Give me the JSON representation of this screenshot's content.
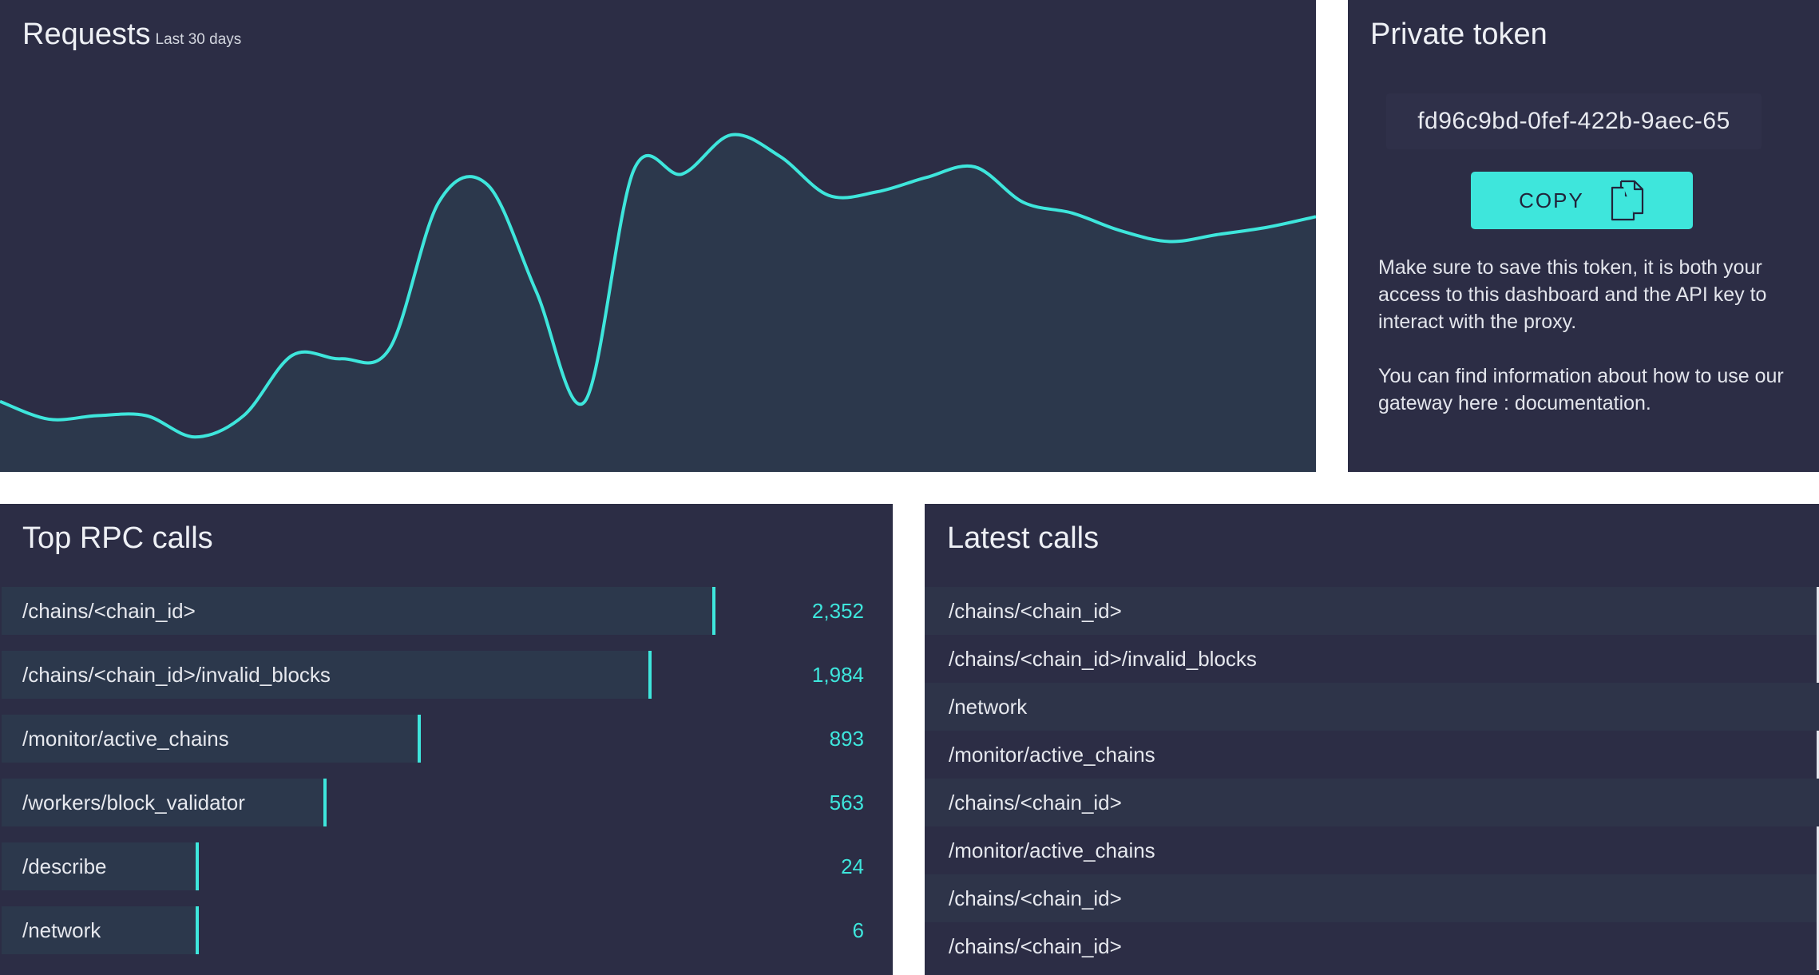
{
  "requests": {
    "title": "Requests",
    "subtitle": "Last 30 days",
    "colors": {
      "line": "#3ee6dc",
      "area": "#2c384c"
    }
  },
  "chart_data": {
    "type": "area",
    "title": "Requests",
    "subtitle": "Last 30 days",
    "xlabel": "",
    "ylabel": "",
    "grid": false,
    "legend": "none",
    "ylim": [
      0,
      100
    ],
    "x": [
      1,
      2,
      3,
      4,
      5,
      6,
      7,
      8,
      9,
      10,
      11,
      12,
      13,
      14,
      15,
      16,
      17,
      18,
      19,
      20,
      21,
      22,
      23,
      24,
      25,
      26,
      27,
      28
    ],
    "values": [
      14,
      9,
      10,
      10,
      4,
      10,
      27,
      26,
      29,
      70,
      75,
      45,
      14,
      79,
      78,
      89,
      83,
      72,
      73,
      77,
      80,
      70,
      67,
      62,
      59,
      61,
      63,
      66
    ]
  },
  "token": {
    "title": "Private token",
    "value": "fd96c9bd-0fef-422b-9aec-65",
    "copy_label": "COPY",
    "note1": "Make sure to save this token, it is both your access to this dashboard and the API key to interact with the proxy.",
    "note2": "You can find information about how to use our gateway here : documentation."
  },
  "top_rpc": {
    "title": "Top RPC calls",
    "max": 2352,
    "items": [
      {
        "label": "/chains/<chain_id>",
        "count": "2,352",
        "value": 2352
      },
      {
        "label": "/chains/<chain_id>/invalid_blocks",
        "count": "1,984",
        "value": 1984
      },
      {
        "label": "/monitor/active_chains",
        "count": "893",
        "value": 893
      },
      {
        "label": "/workers/block_validator",
        "count": "563",
        "value": 563
      },
      {
        "label": "/describe",
        "count": "24",
        "value": 24
      },
      {
        "label": "/network",
        "count": "6",
        "value": 6
      }
    ]
  },
  "latest": {
    "title": "Latest calls",
    "items": [
      "/chains/<chain_id>",
      "/chains/<chain_id>/invalid_blocks",
      "/network",
      "/monitor/active_chains",
      "/chains/<chain_id>",
      "/monitor/active_chains",
      "/chains/<chain_id>",
      "/chains/<chain_id>"
    ]
  }
}
